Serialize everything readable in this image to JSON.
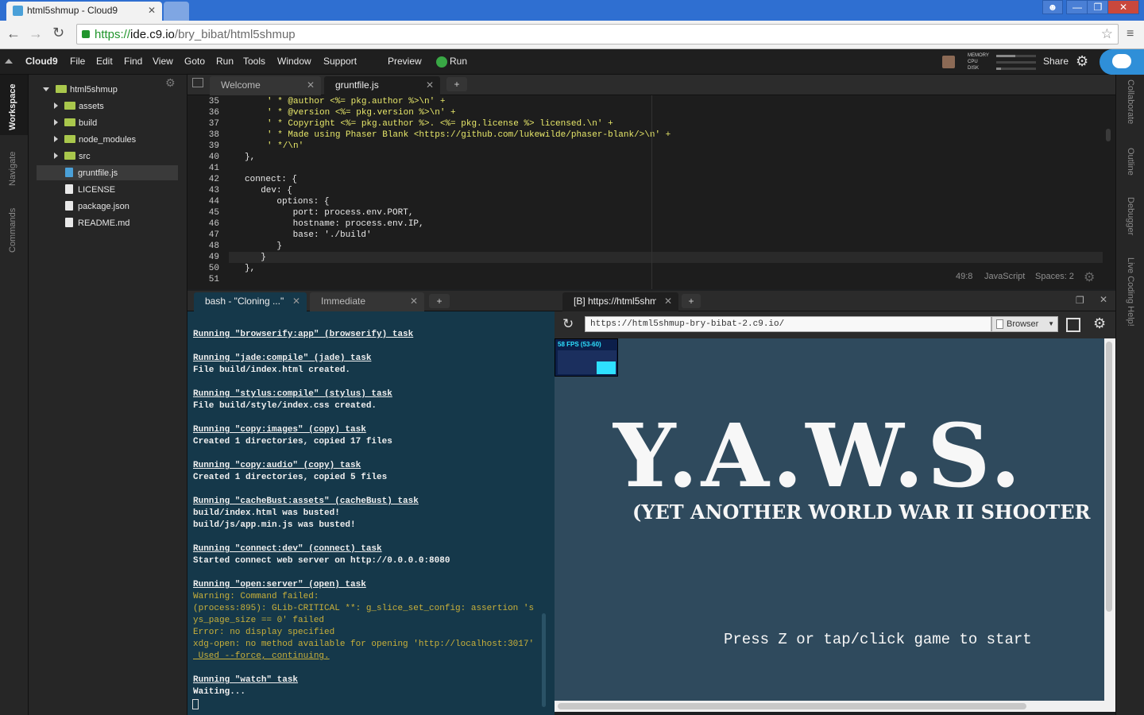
{
  "browser": {
    "tabs": [
      {
        "label": "html5shmup - Cloud9"
      },
      {
        "label": ""
      }
    ],
    "url_protocol": "https://",
    "url_host": "ide.c9.io",
    "url_path": "/bry_bibat/html5shmup"
  },
  "ide": {
    "brand": "Cloud9",
    "menu": [
      "File",
      "Edit",
      "Find",
      "View",
      "Goto",
      "Run",
      "Tools",
      "Window",
      "Support"
    ],
    "preview_label": "Preview",
    "run_label": "Run",
    "share_label": "Share",
    "meters": [
      "MEMORY",
      "CPU",
      "DISK"
    ],
    "left_rail": [
      "Workspace",
      "Navigate",
      "Commands"
    ],
    "right_rail": [
      "Collaborate",
      "Outline",
      "Debugger",
      "Live Coding Help!"
    ]
  },
  "filetree": {
    "root": "html5shmup",
    "items": [
      {
        "label": "assets",
        "type": "folder"
      },
      {
        "label": "build",
        "type": "folder"
      },
      {
        "label": "node_modules",
        "type": "folder"
      },
      {
        "label": "src",
        "type": "folder"
      },
      {
        "label": "gruntfile.js",
        "type": "file",
        "selected": true
      },
      {
        "label": "LICENSE",
        "type": "file"
      },
      {
        "label": "package.json",
        "type": "file"
      },
      {
        "label": "README.md",
        "type": "file"
      }
    ]
  },
  "editor": {
    "tabs": [
      {
        "label": "Welcome",
        "active": false
      },
      {
        "label": "gruntfile.js",
        "active": true
      }
    ],
    "line_numbers": [
      "35",
      "36",
      "37",
      "38",
      "39",
      "40",
      "41",
      "42",
      "43",
      "44",
      "45",
      "46",
      "47",
      "48",
      "49",
      "50",
      "51"
    ],
    "lines": [
      "' * @author <%= pkg.author %>\\n' +",
      "' * @version <%= pkg.version %>\\n' +",
      "' * Copyright <%= pkg.author %>. <%= pkg.license %> licensed.\\n' +",
      "' * Made using Phaser Blank <https://github.com/lukewilde/phaser-blank/>\\n' +",
      "' */\\n'",
      "},",
      "",
      "connect: {",
      "  dev: {",
      "    options: {",
      "      port: process.env.PORT,",
      "      hostname: process.env.IP,",
      "      base: './build'",
      "    }",
      "  }",
      "},",
      ""
    ],
    "status": {
      "position": "49:8",
      "language": "JavaScript",
      "spaces": "Spaces: 2"
    }
  },
  "terminal": {
    "tabs": [
      {
        "label": "bash - \"Cloning ...\""
      },
      {
        "label": "Immediate"
      }
    ],
    "lines": [
      {
        "t": "Running \"browserify:app\" (browserify) task",
        "s": "task"
      },
      {
        "t": "",
        "s": ""
      },
      {
        "t": "Running \"jade:compile\" (jade) task",
        "s": "task"
      },
      {
        "t": "File build/index.html created.",
        "s": "file"
      },
      {
        "t": "",
        "s": ""
      },
      {
        "t": "Running \"stylus:compile\" (stylus) task",
        "s": "task"
      },
      {
        "t": "File build/style/index.css created.",
        "s": "file"
      },
      {
        "t": "",
        "s": ""
      },
      {
        "t": "Running \"copy:images\" (copy) task",
        "s": "task"
      },
      {
        "t": "Created 1 directories, copied 17 files",
        "s": "plain"
      },
      {
        "t": "",
        "s": ""
      },
      {
        "t": "Running \"copy:audio\" (copy) task",
        "s": "task"
      },
      {
        "t": "Created 1 directories, copied 5 files",
        "s": "plain"
      },
      {
        "t": "",
        "s": ""
      },
      {
        "t": "Running \"cacheBust:assets\" (cacheBust) task",
        "s": "task"
      },
      {
        "t": "build/index.html was busted!",
        "s": "plain"
      },
      {
        "t": "build/js/app.min.js was busted!",
        "s": "plain"
      },
      {
        "t": "",
        "s": ""
      },
      {
        "t": "Running \"connect:dev\" (connect) task",
        "s": "task"
      },
      {
        "t": "Started connect web server on http://0.0.0.0:8080",
        "s": "plain"
      },
      {
        "t": "",
        "s": ""
      },
      {
        "t": "Running \"open:server\" (open) task",
        "s": "task"
      },
      {
        "t": "Warning: Command failed:",
        "s": "warn"
      },
      {
        "t": "(process:895): GLib-CRITICAL **: g_slice_set_config: assertion 's",
        "s": "warn"
      },
      {
        "t": "ys_page_size == 0' failed",
        "s": "warn"
      },
      {
        "t": "Error: no display specified",
        "s": "warn"
      },
      {
        "t": "xdg-open: no method available for opening 'http://localhost:3017'",
        "s": "warn"
      },
      {
        "t": " Used --force, continuing.",
        "s": "warnu"
      },
      {
        "t": "",
        "s": ""
      },
      {
        "t": "Running \"watch\" task",
        "s": "task"
      },
      {
        "t": "Waiting...",
        "s": "plain"
      }
    ]
  },
  "preview": {
    "tab_label": "[B] https://html5shmu",
    "url": "https://html5shmup-bry-bibat-2.c9.io/",
    "mode_label": "Browser",
    "fps_label": "58 FPS (53-60)",
    "game_title": "Y.A.W.S.",
    "game_subtitle": "(YET ANOTHER WORLD WAR II SHOOTER",
    "game_prompt": "Press Z or tap/click game to start"
  }
}
